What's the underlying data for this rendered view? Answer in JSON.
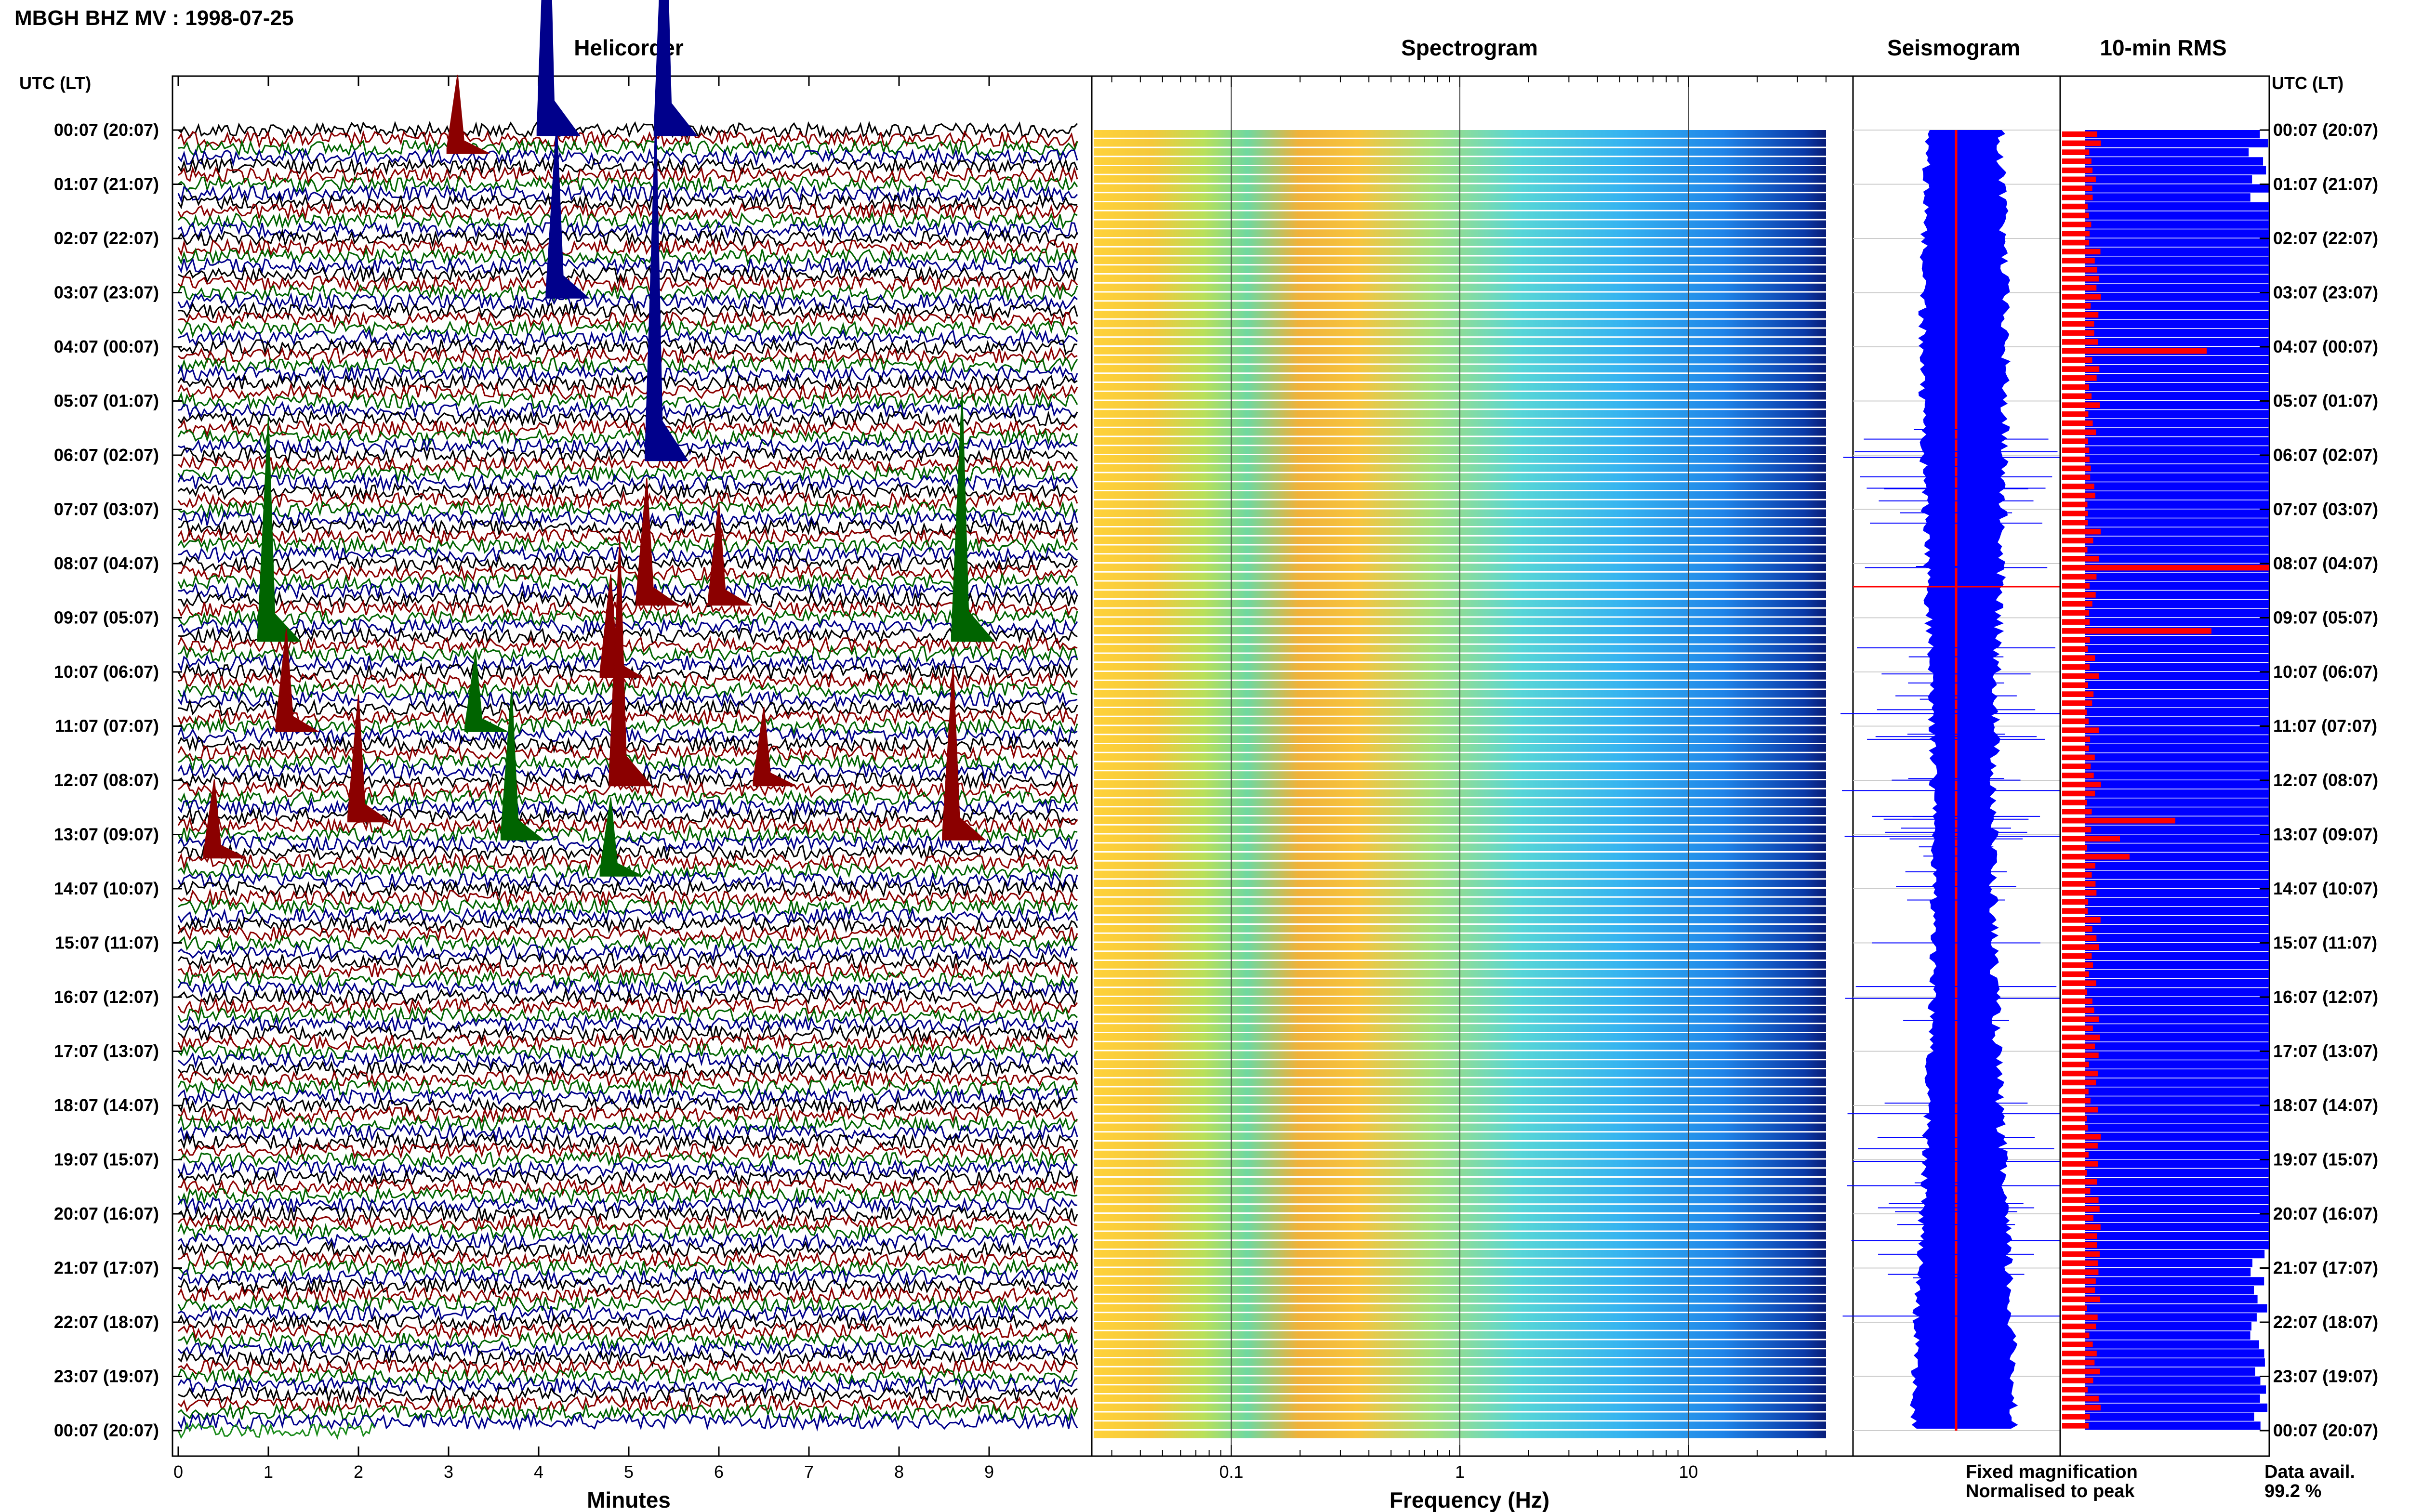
{
  "header": {
    "title": "MBGH BHZ MV : 1998-07-25"
  },
  "panels": {
    "helicorder": {
      "title": "Helicorder",
      "xlabel": "Minutes"
    },
    "spectrogram": {
      "title": "Spectrogram",
      "xlabel": "Frequency (Hz)"
    },
    "seismogram": {
      "title": "Seismogram"
    },
    "rms": {
      "title": "10-min RMS"
    }
  },
  "axis_left_label": "UTC (LT)",
  "axis_right_label": "UTC (LT)",
  "legend": {
    "fixed": "Fixed magnification",
    "fixed_color": "#1010ff",
    "normalised": "Normalised to peak",
    "normalised_color": "#ff1010",
    "avail_label": "Data avail.",
    "avail_value": "99.2 %"
  },
  "colors": {
    "trace_cycle": [
      "#000000",
      "#8b0000",
      "#006400",
      "#00008b"
    ],
    "seismogram": "#0000ff",
    "rms_fixed": "#0000ff",
    "rms_norm": "#ff0000"
  },
  "chart_data": [
    {
      "type": "line",
      "name": "helicorder",
      "title": "Helicorder",
      "xlabel": "Minutes",
      "xlim": [
        0,
        10
      ],
      "xticks": [
        "0",
        "1",
        "2",
        "3",
        "4",
        "5",
        "6",
        "7",
        "8",
        "9"
      ],
      "ytick_labels": [
        "00:07 (20:07)",
        "01:07 (21:07)",
        "02:07 (22:07)",
        "03:07 (23:07)",
        "04:07 (00:07)",
        "05:07 (01:07)",
        "06:07 (02:07)",
        "07:07 (03:07)",
        "08:07 (04:07)",
        "09:07 (05:07)",
        "10:07 (06:07)",
        "11:07 (07:07)",
        "12:07 (08:07)",
        "13:07 (09:07)",
        "14:07 (10:07)",
        "15:07 (11:07)",
        "16:07 (12:07)",
        "17:07 (13:07)",
        "18:07 (14:07)",
        "19:07 (15:07)",
        "20:07 (16:07)",
        "21:07 (17:07)",
        "22:07 (18:07)",
        "23:07 (19:07)",
        "00:07 (20:07)"
      ],
      "traces_per_hour": 6,
      "events": [
        {
          "row": 0,
          "minute": 4.1,
          "amp": 6.0,
          "color": "#00008b"
        },
        {
          "row": 0,
          "minute": 5.4,
          "amp": 5.5,
          "color": "#00008b"
        },
        {
          "row": 2,
          "minute": 3.1,
          "amp": 1.5,
          "color": "#8b0000"
        },
        {
          "row": 18,
          "minute": 4.2,
          "amp": 3.5,
          "color": "#00008b"
        },
        {
          "row": 36,
          "minute": 5.3,
          "amp": 7.0,
          "color": "#00008b"
        },
        {
          "row": 56,
          "minute": 1.0,
          "amp": 4.5,
          "color": "#006400"
        },
        {
          "row": 56,
          "minute": 8.7,
          "amp": 5.0,
          "color": "#006400"
        },
        {
          "row": 52,
          "minute": 5.2,
          "amp": 2.5,
          "color": "#8b0000"
        },
        {
          "row": 52,
          "minute": 6.0,
          "amp": 2.0,
          "color": "#8b0000"
        },
        {
          "row": 60,
          "minute": 4.8,
          "amp": 2.0,
          "color": "#8b0000"
        },
        {
          "row": 66,
          "minute": 1.2,
          "amp": 2.0,
          "color": "#8b0000"
        },
        {
          "row": 66,
          "minute": 3.3,
          "amp": 1.5,
          "color": "#006400"
        },
        {
          "row": 72,
          "minute": 6.5,
          "amp": 1.5,
          "color": "#8b0000"
        },
        {
          "row": 72,
          "minute": 4.9,
          "amp": 5.0,
          "color": "#8b0000"
        },
        {
          "row": 76,
          "minute": 2.0,
          "amp": 2.5,
          "color": "#8b0000"
        },
        {
          "row": 80,
          "minute": 0.4,
          "amp": 1.5,
          "color": "#8b0000"
        },
        {
          "row": 78,
          "minute": 3.7,
          "amp": 3.0,
          "color": "#006400"
        },
        {
          "row": 78,
          "minute": 8.6,
          "amp": 3.5,
          "color": "#8b0000"
        },
        {
          "row": 82,
          "minute": 4.8,
          "amp": 1.5,
          "color": "#006400"
        }
      ]
    },
    {
      "type": "heatmap",
      "name": "spectrogram",
      "title": "Spectrogram",
      "xlabel": "Frequency (Hz)",
      "xscale": "log",
      "xlim": [
        0.025,
        40
      ],
      "xticks": [
        0.1,
        1,
        10
      ],
      "xtick_labels": [
        "0.1",
        "1",
        "10"
      ]
    },
    {
      "type": "line",
      "name": "seismogram",
      "title": "Seismogram",
      "legend": [
        "Fixed magnification",
        "Normalised to peak"
      ]
    },
    {
      "type": "bar",
      "name": "rms",
      "title": "10-min RMS",
      "orientation": "horizontal",
      "data_availability": "99.2 %"
    }
  ]
}
